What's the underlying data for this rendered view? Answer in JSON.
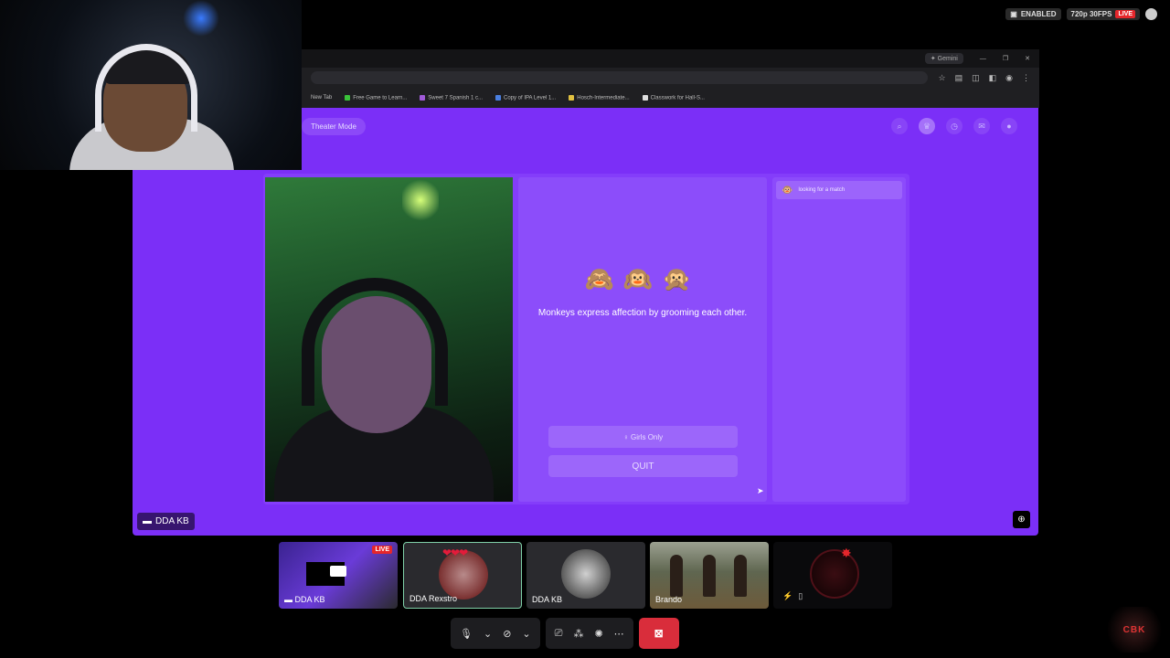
{
  "stream_status": {
    "enabled_label": "ENABLED",
    "quality": "720p 30FPS",
    "live_label": "LIVE"
  },
  "browser": {
    "profile_tab": "Gemini",
    "bookmarks": [
      {
        "label": "New Tab",
        "color": "#888888"
      },
      {
        "label": "Free Game to Learn...",
        "color": "#3ac23a"
      },
      {
        "label": "Sweet 7 Spanish 1 c...",
        "color": "#a05ad8"
      },
      {
        "label": "Copy of IPA Level 1...",
        "color": "#4a7fe0"
      },
      {
        "label": "Hosch-Intermediate...",
        "color": "#e0c040"
      },
      {
        "label": "Classwork for Hall-S...",
        "color": "#dddddd"
      }
    ]
  },
  "page": {
    "theater_mode": "Theater Mode",
    "emojis": "🙈🙉🙊",
    "fact": "Monkeys express affection by grooming each other.",
    "girls_only_button": "Girls Only",
    "quit_button": "QUIT",
    "match_status": "looking for a match",
    "main_speaker": "DDA KB"
  },
  "participants": [
    {
      "name": "DDA KB",
      "live": "LIVE"
    },
    {
      "name": "DDA Rexstro"
    },
    {
      "name": "DDA KB"
    },
    {
      "name": "Brando"
    },
    {
      "name": ""
    }
  ],
  "logo_text": "CBK",
  "colors": {
    "page_bg": "#7b2ff7",
    "center_card": "#8c4dfa",
    "leave_button": "#d92d3b",
    "live_badge": "#e5262b"
  }
}
